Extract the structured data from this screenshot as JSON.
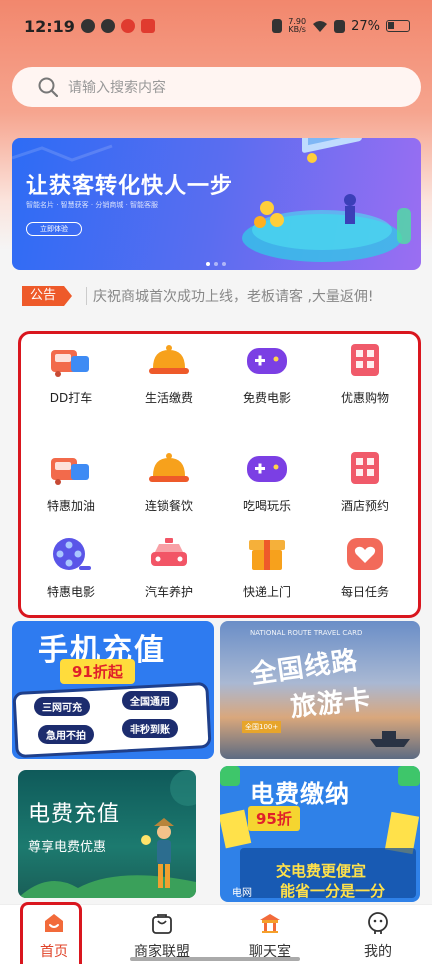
{
  "status_bar": {
    "time": "12:19",
    "net_speed_value": "7.90",
    "net_speed_unit": "KB/s",
    "battery": "27%"
  },
  "search": {
    "placeholder": "请输入搜索内容"
  },
  "banner": {
    "title": "让获客转化快人一步",
    "subtitle": "智能名片 · 智慧获客 · 分销商城 · 智能客服",
    "button": "立即体验"
  },
  "notice": {
    "tag": "公告",
    "text": "庆祝商城首次成功上线，老板请客 ,大量返佣!"
  },
  "services": [
    {
      "label": "DD打车",
      "icon": "car-icon"
    },
    {
      "label": "生活缴费",
      "icon": "food-cover-icon"
    },
    {
      "label": "免费电影",
      "icon": "gamepad-icon"
    },
    {
      "label": "优惠购物",
      "icon": "building-icon"
    },
    {
      "label": "特惠加油",
      "icon": "car-icon"
    },
    {
      "label": "连锁餐饮",
      "icon": "food-cover-icon"
    },
    {
      "label": "吃喝玩乐",
      "icon": "gamepad-icon"
    },
    {
      "label": "酒店预约",
      "icon": "building-icon"
    },
    {
      "label": "特惠电影",
      "icon": "film-reel-icon"
    },
    {
      "label": "汽车养护",
      "icon": "taxi-icon"
    },
    {
      "label": "快递上门",
      "icon": "gift-box-icon"
    },
    {
      "label": "每日任务",
      "icon": "heart-icon"
    }
  ],
  "promos": {
    "recharge": {
      "title": "手机充值",
      "discount": "91折起",
      "tags": [
        "三网可充",
        "全国通用",
        "急用不拍",
        "非秒到账"
      ]
    },
    "travel": {
      "title_line1": "全国线路",
      "title_line2": "旅游卡",
      "top_text": "NATIONAL ROUTE TRAVEL CARD",
      "badge": "全国100+"
    },
    "electric_recharge": {
      "title": "电费充值",
      "subtitle": "尊享电费优惠"
    },
    "electric_pay": {
      "title": "电费缴纳",
      "discount": "95折",
      "line1": "交电费更便宜",
      "line2": "能省一分是一分",
      "logo": "电网"
    }
  },
  "tabbar": [
    {
      "label": "首页",
      "icon": "home-icon",
      "active": true
    },
    {
      "label": "商家联盟",
      "icon": "shopping-bag-icon",
      "active": false
    },
    {
      "label": "聊天室",
      "icon": "pavilion-icon",
      "active": false
    },
    {
      "label": "我的",
      "icon": "user-icon",
      "active": false
    }
  ],
  "colors": {
    "accent": "#e0442a",
    "highlight_border": "#d9161e",
    "header_gradient_top": "#f2876d"
  }
}
